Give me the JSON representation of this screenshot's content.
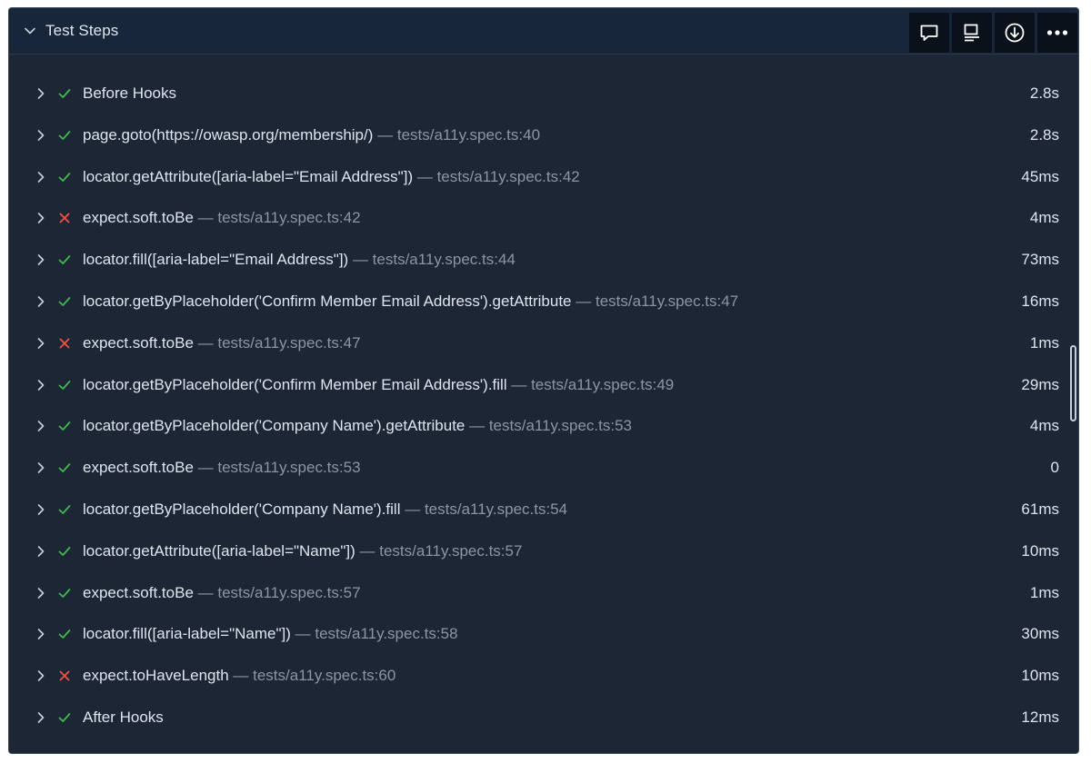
{
  "header": {
    "title": "Test Steps"
  },
  "toolbar": {
    "buttons": [
      {
        "icon": "comment-icon"
      },
      {
        "icon": "log-icon"
      },
      {
        "icon": "download-icon"
      },
      {
        "icon": "more-icon"
      }
    ]
  },
  "colors": {
    "pass": "#3fb950",
    "fail": "#f85149",
    "location": "#8b96a5",
    "text": "#dfe5ee"
  },
  "steps": [
    {
      "status": "pass",
      "title": "Before Hooks",
      "location": "",
      "duration": "2.8s"
    },
    {
      "status": "pass",
      "title": "page.goto(https://owasp.org/membership/)",
      "location": "— tests/a11y.spec.ts:40",
      "duration": "2.8s"
    },
    {
      "status": "pass",
      "title": "locator.getAttribute([aria-label=\"Email Address\"])",
      "location": "— tests/a11y.spec.ts:42",
      "duration": "45ms"
    },
    {
      "status": "fail",
      "title": "expect.soft.toBe",
      "location": "— tests/a11y.spec.ts:42",
      "duration": "4ms"
    },
    {
      "status": "pass",
      "title": "locator.fill([aria-label=\"Email Address\"])",
      "location": "— tests/a11y.spec.ts:44",
      "duration": "73ms"
    },
    {
      "status": "pass",
      "title": "locator.getByPlaceholder('Confirm Member Email Address').getAttribute",
      "location": "— tests/a11y.spec.ts:47",
      "duration": "16ms"
    },
    {
      "status": "fail",
      "title": "expect.soft.toBe",
      "location": "— tests/a11y.spec.ts:47",
      "duration": "1ms"
    },
    {
      "status": "pass",
      "title": "locator.getByPlaceholder('Confirm Member Email Address').fill",
      "location": "— tests/a11y.spec.ts:49",
      "duration": "29ms"
    },
    {
      "status": "pass",
      "title": "locator.getByPlaceholder('Company Name').getAttribute",
      "location": "— tests/a11y.spec.ts:53",
      "duration": "4ms"
    },
    {
      "status": "pass",
      "title": "expect.soft.toBe",
      "location": "— tests/a11y.spec.ts:53",
      "duration": "0"
    },
    {
      "status": "pass",
      "title": "locator.getByPlaceholder('Company Name').fill",
      "location": "— tests/a11y.spec.ts:54",
      "duration": "61ms"
    },
    {
      "status": "pass",
      "title": "locator.getAttribute([aria-label=\"Name\"])",
      "location": "— tests/a11y.spec.ts:57",
      "duration": "10ms"
    },
    {
      "status": "pass",
      "title": "expect.soft.toBe",
      "location": "— tests/a11y.spec.ts:57",
      "duration": "1ms"
    },
    {
      "status": "pass",
      "title": "locator.fill([aria-label=\"Name\"])",
      "location": "— tests/a11y.spec.ts:58",
      "duration": "30ms"
    },
    {
      "status": "fail",
      "title": "expect.toHaveLength",
      "location": "— tests/a11y.spec.ts:60",
      "duration": "10ms"
    },
    {
      "status": "pass",
      "title": "After Hooks",
      "location": "",
      "duration": "12ms"
    }
  ]
}
